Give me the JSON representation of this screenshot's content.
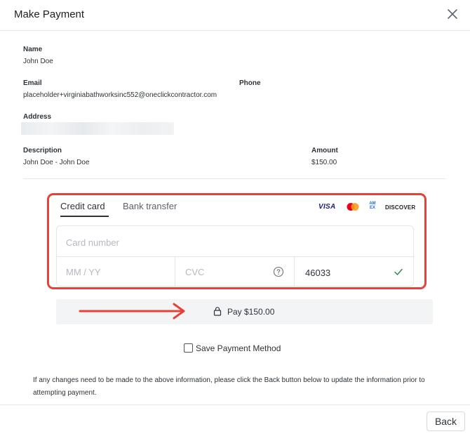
{
  "modal": {
    "title": "Make Payment"
  },
  "customer": {
    "name_label": "Name",
    "name": "John Doe",
    "email_label": "Email",
    "email": "placeholder+virginiabathworksinc552@oneclickcontractor.com",
    "phone_label": "Phone",
    "phone": "",
    "address_label": "Address"
  },
  "invoice": {
    "description_label": "Description",
    "description": "John Doe - John Doe",
    "amount_label": "Amount",
    "amount": "$150.00"
  },
  "payment": {
    "tabs": [
      "Credit card",
      "Bank transfer"
    ],
    "active_tab": "Credit card",
    "brands": {
      "visa": "VISA",
      "amex": "AM EX",
      "discover": "DISCOVER"
    },
    "card_number_placeholder": "Card number",
    "expiry_placeholder": "MM / YY",
    "cvc_placeholder": "CVC",
    "zip_value": "46033",
    "pay_label": "Pay $150.00",
    "highlight_color": "#e6423a"
  },
  "save_method_label": "Save Payment Method",
  "info_text": "If any changes need to be made to the above information, please click the Back button below to update the information prior to attempting payment.",
  "back_label": "Back",
  "icons": [
    "close-icon",
    "help-icon",
    "check-icon",
    "lock-icon",
    "arrow-right-icon",
    "mastercard-icon"
  ]
}
